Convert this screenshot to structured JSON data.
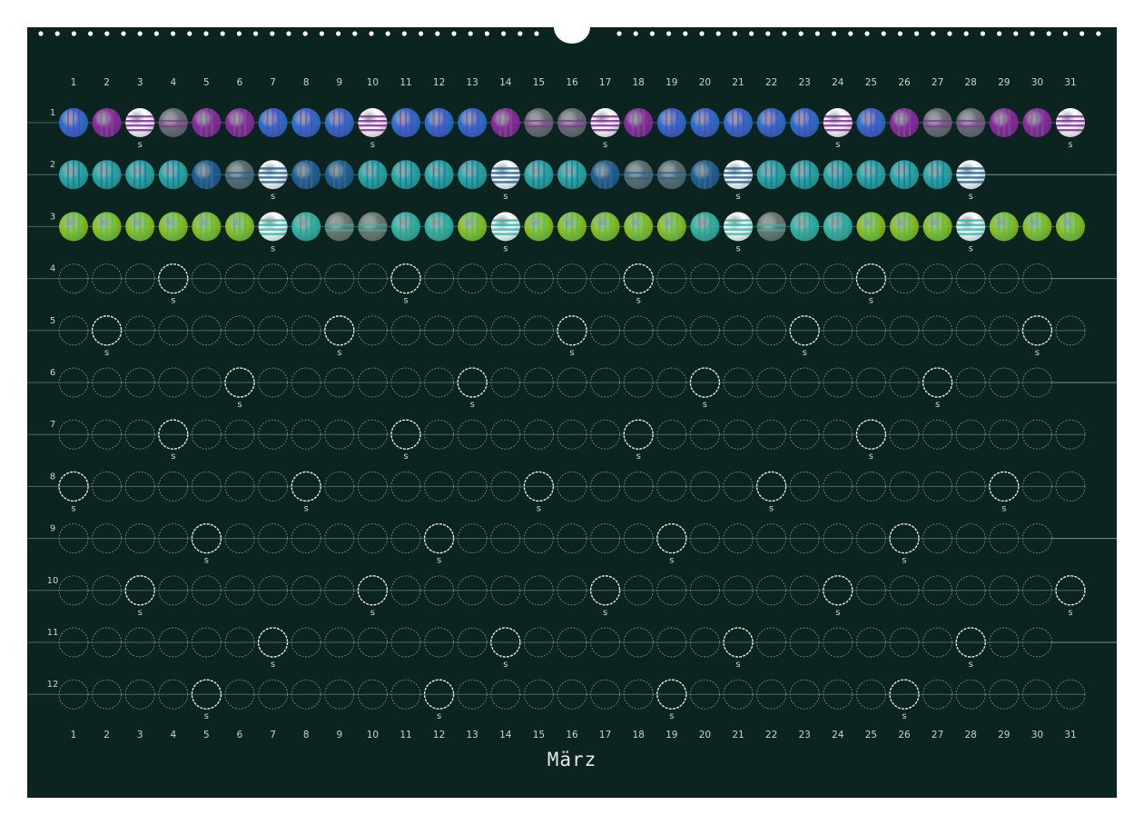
{
  "title": "März",
  "day_numbers": [
    "1",
    "2",
    "3",
    "4",
    "5",
    "6",
    "7",
    "8",
    "9",
    "10",
    "11",
    "12",
    "13",
    "14",
    "15",
    "16",
    "17",
    "18",
    "19",
    "20",
    "21",
    "22",
    "23",
    "24",
    "25",
    "26",
    "27",
    "28",
    "29",
    "30",
    "31"
  ],
  "month_numbers": [
    "1",
    "2",
    "3",
    "4",
    "5",
    "6",
    "7",
    "8",
    "9",
    "10",
    "11",
    "12"
  ],
  "sunday_marker": "s",
  "colors": {
    "background": "#0c2420",
    "page": "#ffffff",
    "text": "#c9d2cf",
    "empty_circle": "#6f8580",
    "sunday_circle": "#f2f2f2",
    "palette_jan": [
      "#2f6fd0",
      "#8b2aa0",
      "#6a6e78",
      "#ffffff"
    ],
    "palette_feb": [
      "#2aa9a7",
      "#1f5f98",
      "#5b6f74",
      "#ffffff"
    ],
    "palette_mar": [
      "#8ac423",
      "#2fb7a8",
      "#6b7a74",
      "#ffffff"
    ]
  },
  "months": [
    {
      "days": 31,
      "sundays": [
        3,
        10,
        17,
        24,
        31
      ],
      "filled": true,
      "palette": "palette_jan"
    },
    {
      "days": 28,
      "sundays": [
        7,
        14,
        21,
        28
      ],
      "filled": true,
      "palette": "palette_feb"
    },
    {
      "days": 31,
      "sundays": [
        7,
        14,
        21,
        28
      ],
      "filled": true,
      "palette": "palette_mar"
    },
    {
      "days": 30,
      "sundays": [
        4,
        11,
        18,
        25
      ],
      "filled": false
    },
    {
      "days": 31,
      "sundays": [
        2,
        9,
        16,
        23,
        30
      ],
      "filled": false
    },
    {
      "days": 30,
      "sundays": [
        6,
        13,
        20,
        27
      ],
      "filled": false
    },
    {
      "days": 31,
      "sundays": [
        4,
        11,
        18,
        25
      ],
      "filled": false
    },
    {
      "days": 31,
      "sundays": [
        1,
        8,
        15,
        22,
        29
      ],
      "filled": false
    },
    {
      "days": 30,
      "sundays": [
        5,
        12,
        19,
        26
      ],
      "filled": false
    },
    {
      "days": 31,
      "sundays": [
        3,
        10,
        17,
        24,
        31
      ],
      "filled": false
    },
    {
      "days": 30,
      "sundays": [
        7,
        14,
        21,
        28
      ],
      "filled": false
    },
    {
      "days": 31,
      "sundays": [
        5,
        12,
        19,
        26
      ],
      "filled": false
    }
  ]
}
